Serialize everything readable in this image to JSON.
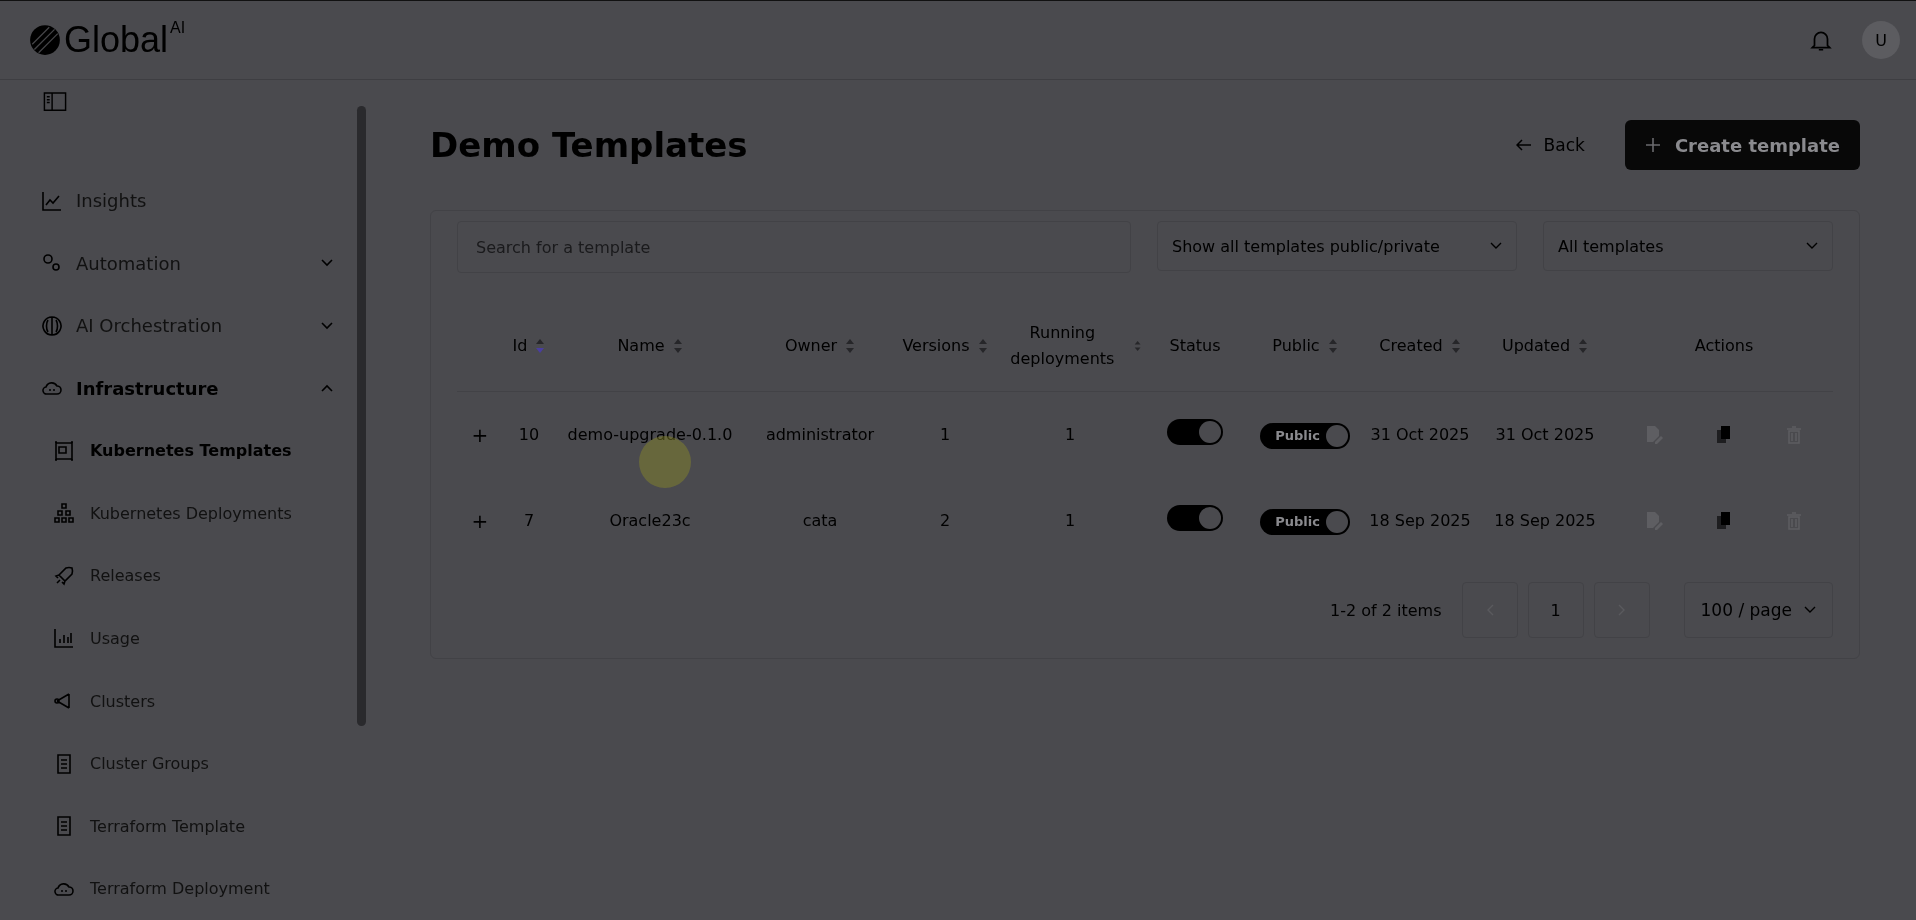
{
  "header": {
    "logo": "Global",
    "logo_sup": "AI",
    "avatar": "U"
  },
  "sidebar": {
    "items": [
      {
        "label": "Insights",
        "kind": "link",
        "selected": false
      },
      {
        "label": "Automation",
        "kind": "group",
        "expanded": false,
        "selected": false
      },
      {
        "label": "AI Orchestration",
        "kind": "group",
        "expanded": false,
        "selected": false
      },
      {
        "label": "Infrastructure",
        "kind": "group",
        "expanded": true,
        "selected": true,
        "children": [
          {
            "label": "Kubernetes Templates",
            "selected": true
          },
          {
            "label": "Kubernetes Deployments",
            "selected": false
          },
          {
            "label": "Releases",
            "selected": false
          },
          {
            "label": "Usage",
            "selected": false
          },
          {
            "label": "Clusters",
            "selected": false
          },
          {
            "label": "Cluster Groups",
            "selected": false
          },
          {
            "label": "Terraform Template",
            "selected": false
          },
          {
            "label": "Terraform Deployment",
            "selected": false
          }
        ]
      }
    ]
  },
  "page": {
    "title": "Demo Templates",
    "back": "Back",
    "create": "Create template"
  },
  "filters": {
    "search": {
      "placeholder": "Search for a template"
    },
    "visibility": "Show all templates public/private",
    "scope": "All templates"
  },
  "table": {
    "columns": [
      {
        "label": "Id",
        "sortable": true,
        "sorted": true
      },
      {
        "label": "Name",
        "sortable": true,
        "sorted": false
      },
      {
        "label": "Owner",
        "sortable": true,
        "sorted": false
      },
      {
        "label": "Versions",
        "sortable": true,
        "sorted": false
      },
      {
        "label": "Running deployments",
        "sortable": true,
        "sorted": false
      },
      {
        "label": "Status",
        "sortable": false
      },
      {
        "label": "Public",
        "sortable": true,
        "sorted": false
      },
      {
        "label": "Created",
        "sortable": true,
        "sorted": false
      },
      {
        "label": "Updated",
        "sortable": true,
        "sorted": false
      },
      {
        "label": "Actions",
        "sortable": false
      }
    ],
    "rows": [
      {
        "expand": "+",
        "id": "10",
        "name": "demo-upgrade-0.1.0",
        "owner": "administrator",
        "versions": "1",
        "running": "1",
        "status_on": true,
        "public_on": true,
        "public_label": "Public",
        "created": "31 Oct 2025",
        "updated": "31 Oct 2025"
      },
      {
        "expand": "+",
        "id": "7",
        "name": "Oracle23c",
        "owner": "cata",
        "versions": "2",
        "running": "1",
        "status_on": true,
        "public_on": true,
        "public_label": "Public",
        "created": "18 Sep 2025",
        "updated": "18 Sep 2025"
      }
    ]
  },
  "pagination": {
    "summary": "1-2 of 2 items",
    "page": "1",
    "page_size": "100 / page"
  }
}
